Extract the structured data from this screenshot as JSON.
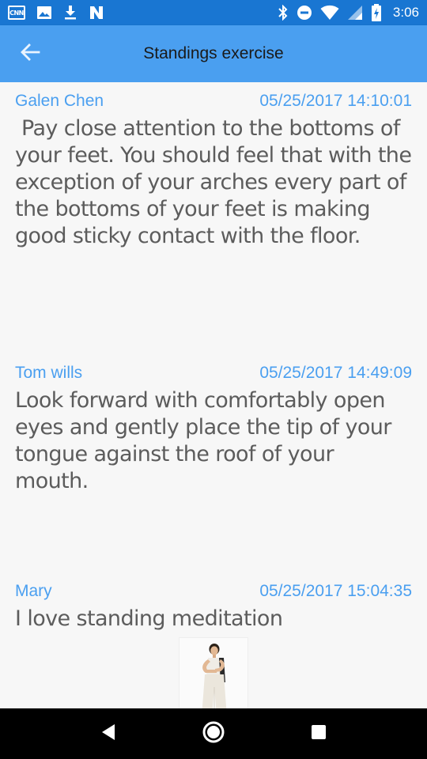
{
  "status_bar": {
    "notification_icons": [
      "cnn-icon",
      "image-icon",
      "download-icon",
      "n-app-icon"
    ],
    "system_icons": [
      "bluetooth-icon",
      "do-not-disturb-icon",
      "wifi-icon",
      "signal-icon",
      "battery-charging-icon"
    ],
    "cnn_text": "CNN",
    "time": "3:06",
    "color": "#1976d2"
  },
  "app_bar": {
    "title": "Standings exercise",
    "back_icon": "arrow-back-icon",
    "color": "#4a9ff0"
  },
  "posts": [
    {
      "author": "Galen Chen",
      "timestamp": "05/25/2017 14:10:01",
      "text": " Pay close attention to the bottoms of your feet. You should feel that with the exception of your arches every part of the bottoms of your feet is making good sticky contact with the floor."
    },
    {
      "author": "Tom wills",
      "timestamp": "05/25/2017 14:49:09",
      "text": "Look forward with comfortably open eyes and gently place the tip of your tongue against the roof of your mouth."
    },
    {
      "author": "Mary",
      "timestamp": "05/25/2017 15:04:35",
      "text": "I love standing meditation",
      "image": "standing-meditation-photo"
    }
  ],
  "nav_bar": {
    "buttons": [
      "back-triangle-icon",
      "home-circle-icon",
      "recents-square-icon"
    ]
  },
  "colors": {
    "accent": "#4a9ff0",
    "body_text": "#5c5c5c",
    "background": "#f7f7f7"
  }
}
